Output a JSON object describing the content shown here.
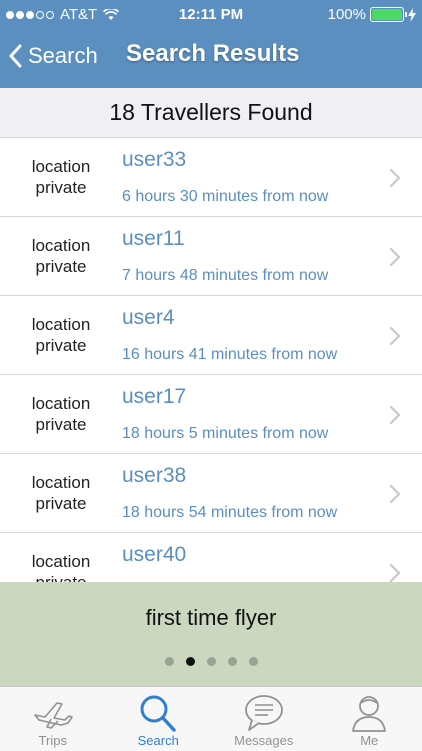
{
  "status_bar": {
    "carrier": "AT&T",
    "time": "12:11 PM",
    "battery": "100%",
    "signal_bars_filled": 3,
    "signal_bars_total": 5
  },
  "navbar": {
    "back_label": "Search",
    "title": "Search Results"
  },
  "results_header": "18 Travellers Found",
  "results": [
    {
      "location": "location private",
      "user": "user33",
      "time": "6 hours 30 minutes from now"
    },
    {
      "location": "location private",
      "user": "user11",
      "time": "7 hours 48 minutes from now"
    },
    {
      "location": "location private",
      "user": "user4",
      "time": "16 hours 41 minutes from now"
    },
    {
      "location": "location private",
      "user": "user17",
      "time": "18 hours 5 minutes from now"
    },
    {
      "location": "location private",
      "user": "user38",
      "time": "18 hours 54 minutes from now"
    },
    {
      "location": "location private",
      "user": "user40",
      "time": ""
    }
  ],
  "banner": {
    "title": "first time flyer",
    "page_count": 5,
    "active_page": 1
  },
  "tabbar": {
    "tabs": [
      {
        "label": "Trips",
        "icon": "airplane-icon"
      },
      {
        "label": "Search",
        "icon": "search-icon"
      },
      {
        "label": "Messages",
        "icon": "speech-bubble-icon"
      },
      {
        "label": "Me",
        "icon": "person-icon"
      }
    ],
    "selected": "Search"
  },
  "colors": {
    "nav_blue": "#5b8fbf",
    "link_blue": "#5b8fbf",
    "tab_selected": "#2f7fd0",
    "banner_green": "#cbd8bf",
    "battery_green": "#4cd964"
  }
}
